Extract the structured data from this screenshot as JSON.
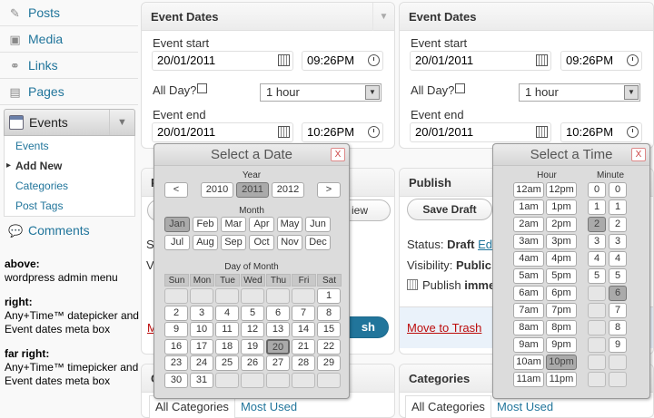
{
  "menu": {
    "items": [
      {
        "label": "Posts",
        "icon": "pin-icon",
        "glyph": "✎"
      },
      {
        "label": "Media",
        "icon": "media-icon",
        "glyph": "▣"
      },
      {
        "label": "Links",
        "icon": "link-icon",
        "glyph": "⚭"
      },
      {
        "label": "Pages",
        "icon": "pages-icon",
        "glyph": "▤"
      }
    ],
    "events_label": "Events",
    "submenu": [
      "Events",
      "Add New",
      "Categories",
      "Post Tags"
    ],
    "comments_label": "Comments"
  },
  "notes": [
    {
      "title": "above:",
      "lines": [
        "wordpress admin menu"
      ]
    },
    {
      "title": "right:",
      "lines": [
        "Any+Time™ datepicker and",
        "Event dates meta box"
      ]
    },
    {
      "title": "far right:",
      "lines": [
        "Any+Time™ timepicker and",
        "Event dates meta box"
      ]
    }
  ],
  "event_dates": {
    "title": "Event Dates",
    "start_label": "Event start",
    "start_date": "20/01/2011",
    "start_time": "09:26PM",
    "allday_label": "All Day?",
    "duration": "1 hour",
    "end_label": "Event end",
    "end_date": "20/01/2011",
    "end_time": "10:26PM"
  },
  "datepicker": {
    "title": "Select a Date",
    "close": "X",
    "year_label": "Year",
    "years": [
      "<",
      "2010",
      "2011",
      "2012",
      ">"
    ],
    "selected_year": "2011",
    "month_label": "Month",
    "months": [
      "Jan",
      "Feb",
      "Mar",
      "Apr",
      "May",
      "Jun",
      "Jul",
      "Aug",
      "Sep",
      "Oct",
      "Nov",
      "Dec"
    ],
    "selected_month": "Jan",
    "dom_label": "Day of Month",
    "weekdays": [
      "Sun",
      "Mon",
      "Tue",
      "Wed",
      "Thu",
      "Fri",
      "Sat"
    ],
    "days": [
      [
        "",
        "",
        "",
        "",
        "",
        "",
        "1"
      ],
      [
        "2",
        "3",
        "4",
        "5",
        "6",
        "7",
        "8"
      ],
      [
        "9",
        "10",
        "11",
        "12",
        "13",
        "14",
        "15"
      ],
      [
        "16",
        "17",
        "18",
        "19",
        "20",
        "21",
        "22"
      ],
      [
        "23",
        "24",
        "25",
        "26",
        "27",
        "28",
        "29"
      ],
      [
        "30",
        "31",
        "",
        "",
        "",
        "",
        ""
      ]
    ],
    "selected_day": "20"
  },
  "timepicker": {
    "title": "Select a Time",
    "close": "X",
    "hour_label": "Hour",
    "minute_label": "Minute",
    "hours_am": [
      "12am",
      "1am",
      "2am",
      "3am",
      "4am",
      "5am",
      "6am",
      "7am",
      "8am",
      "9am",
      "10am",
      "11am"
    ],
    "hours_pm": [
      "12pm",
      "1pm",
      "2pm",
      "3pm",
      "4pm",
      "5pm",
      "6pm",
      "7pm",
      "8pm",
      "9pm",
      "10pm",
      "11pm"
    ],
    "selected_hour": "10pm",
    "minute_tens": [
      "0",
      "1",
      "2",
      "3",
      "4",
      "5"
    ],
    "minute_ones": [
      "0",
      "1",
      "2",
      "3",
      "4",
      "5",
      "6",
      "7",
      "8",
      "9"
    ],
    "selected_tens": "2",
    "selected_ones": "6"
  },
  "publish": {
    "title": "Publish",
    "save_draft": "Save Draft",
    "preview_tail": "iew",
    "status_label": "Status:",
    "status_value": "Draft",
    "status_edit": "Ed",
    "visibility_label": "Visibility:",
    "visibility_value": "Public",
    "publish_label": "Publish",
    "publish_value": "imme",
    "trash_label": "Move to Trash",
    "publish_btn_tail": "sh",
    "partial_left": [
      "P",
      "M",
      "S",
      "V",
      "M"
    ]
  },
  "categories": {
    "title": "Categories",
    "tab_all": "All Categories",
    "tab_used": "Most Used",
    "partial_title": "C"
  }
}
